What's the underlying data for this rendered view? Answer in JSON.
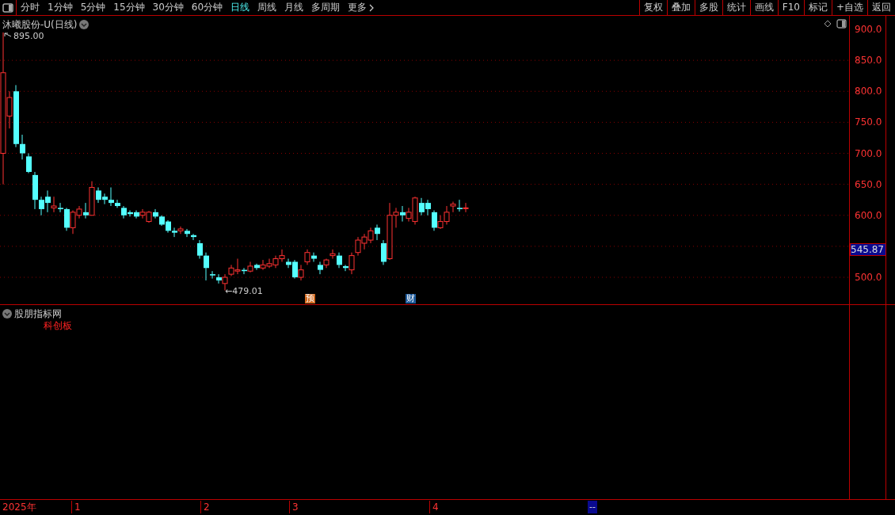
{
  "toolbar": {
    "periods": [
      {
        "label": "分时",
        "selected": false
      },
      {
        "label": "1分钟",
        "selected": false
      },
      {
        "label": "5分钟",
        "selected": false
      },
      {
        "label": "15分钟",
        "selected": false
      },
      {
        "label": "30分钟",
        "selected": false
      },
      {
        "label": "60分钟",
        "selected": false
      },
      {
        "label": "日线",
        "selected": true
      },
      {
        "label": "周线",
        "selected": false
      },
      {
        "label": "月线",
        "selected": false
      },
      {
        "label": "多周期",
        "selected": false
      }
    ],
    "more": "更多",
    "buttons": [
      "复权",
      "叠加",
      "多股",
      "统计",
      "画线",
      "F10",
      "标记",
      "+自选",
      "返回"
    ]
  },
  "chart": {
    "title": "沐曦股份-U(日线)",
    "high_marker": "895.00",
    "low_marker": "←479.01",
    "event_badges": [
      {
        "label": "预",
        "color": "#d2691e"
      },
      {
        "label": "财",
        "color": "#1e5a9a"
      }
    ],
    "price_axis": [
      "900.0",
      "850.0",
      "800.0",
      "750.0",
      "700.0",
      "650.0",
      "600.0",
      "500.0"
    ],
    "current_price": "545.87"
  },
  "indicator": {
    "title": "股朋指标网",
    "tag": "科创板"
  },
  "time_axis": {
    "labels": [
      "2025年",
      "1",
      "2",
      "3",
      "4"
    ],
    "cursor": "--"
  }
}
